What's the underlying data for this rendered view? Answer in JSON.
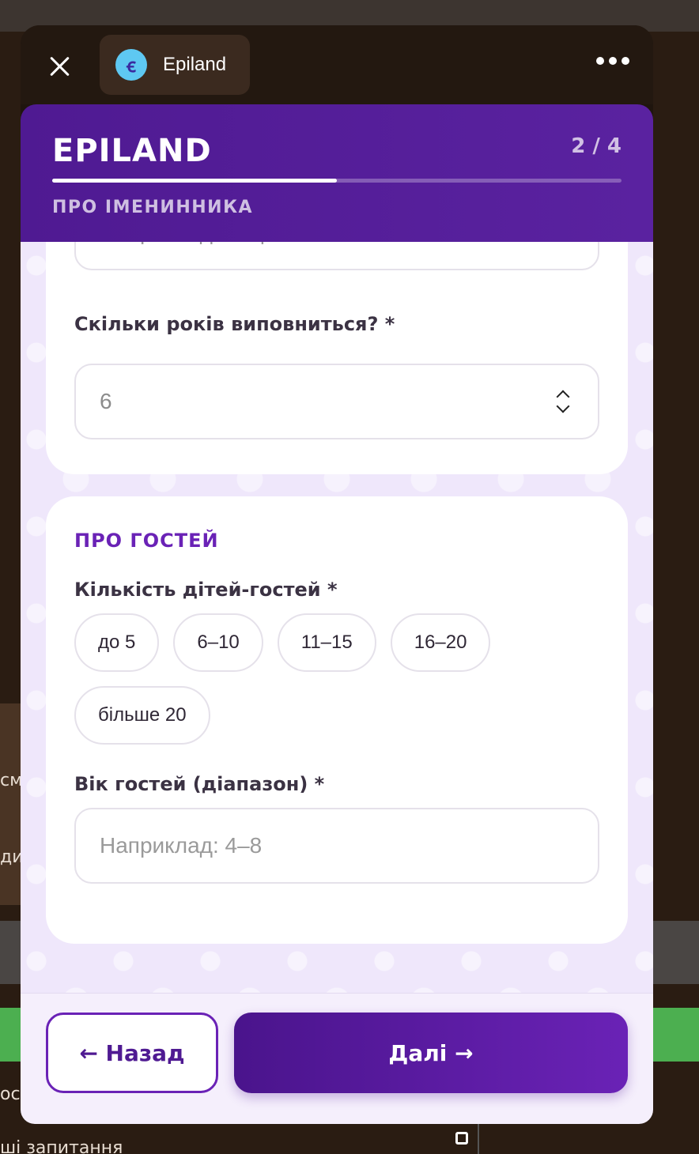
{
  "window": {
    "app_name": "Epiland",
    "app_logo_glyph": "ꞓ"
  },
  "header": {
    "brand": "EPILAND",
    "step": "2 / 4",
    "progress_fraction": 0.5,
    "section": "ПРО ІМЕНИННИКА"
  },
  "birthday": {
    "name_placeholder": "Наприклад: Софія",
    "age_label": "Скільки років виповниться? *",
    "age_value": "6"
  },
  "guests": {
    "title": "ПРО ГОСТЕЙ",
    "count_label": "Кількість дітей-гостей *",
    "count_options": [
      "до 5",
      "6–10",
      "11–15",
      "16–20",
      "більше 20"
    ],
    "age_label": "Вік гостей (діапазон) *",
    "age_placeholder": "Наприклад: 4–8"
  },
  "footer": {
    "back_label": "← Назад",
    "next_label": "Далі →"
  },
  "background": {
    "left_text_1": "см",
    "left_text_2": "ди",
    "left_text_3": "осл",
    "bottom_text": "ші запитання"
  },
  "colors": {
    "accent": "#6a22b6",
    "header": "#4f1a92",
    "bg": "#efe7fb"
  }
}
